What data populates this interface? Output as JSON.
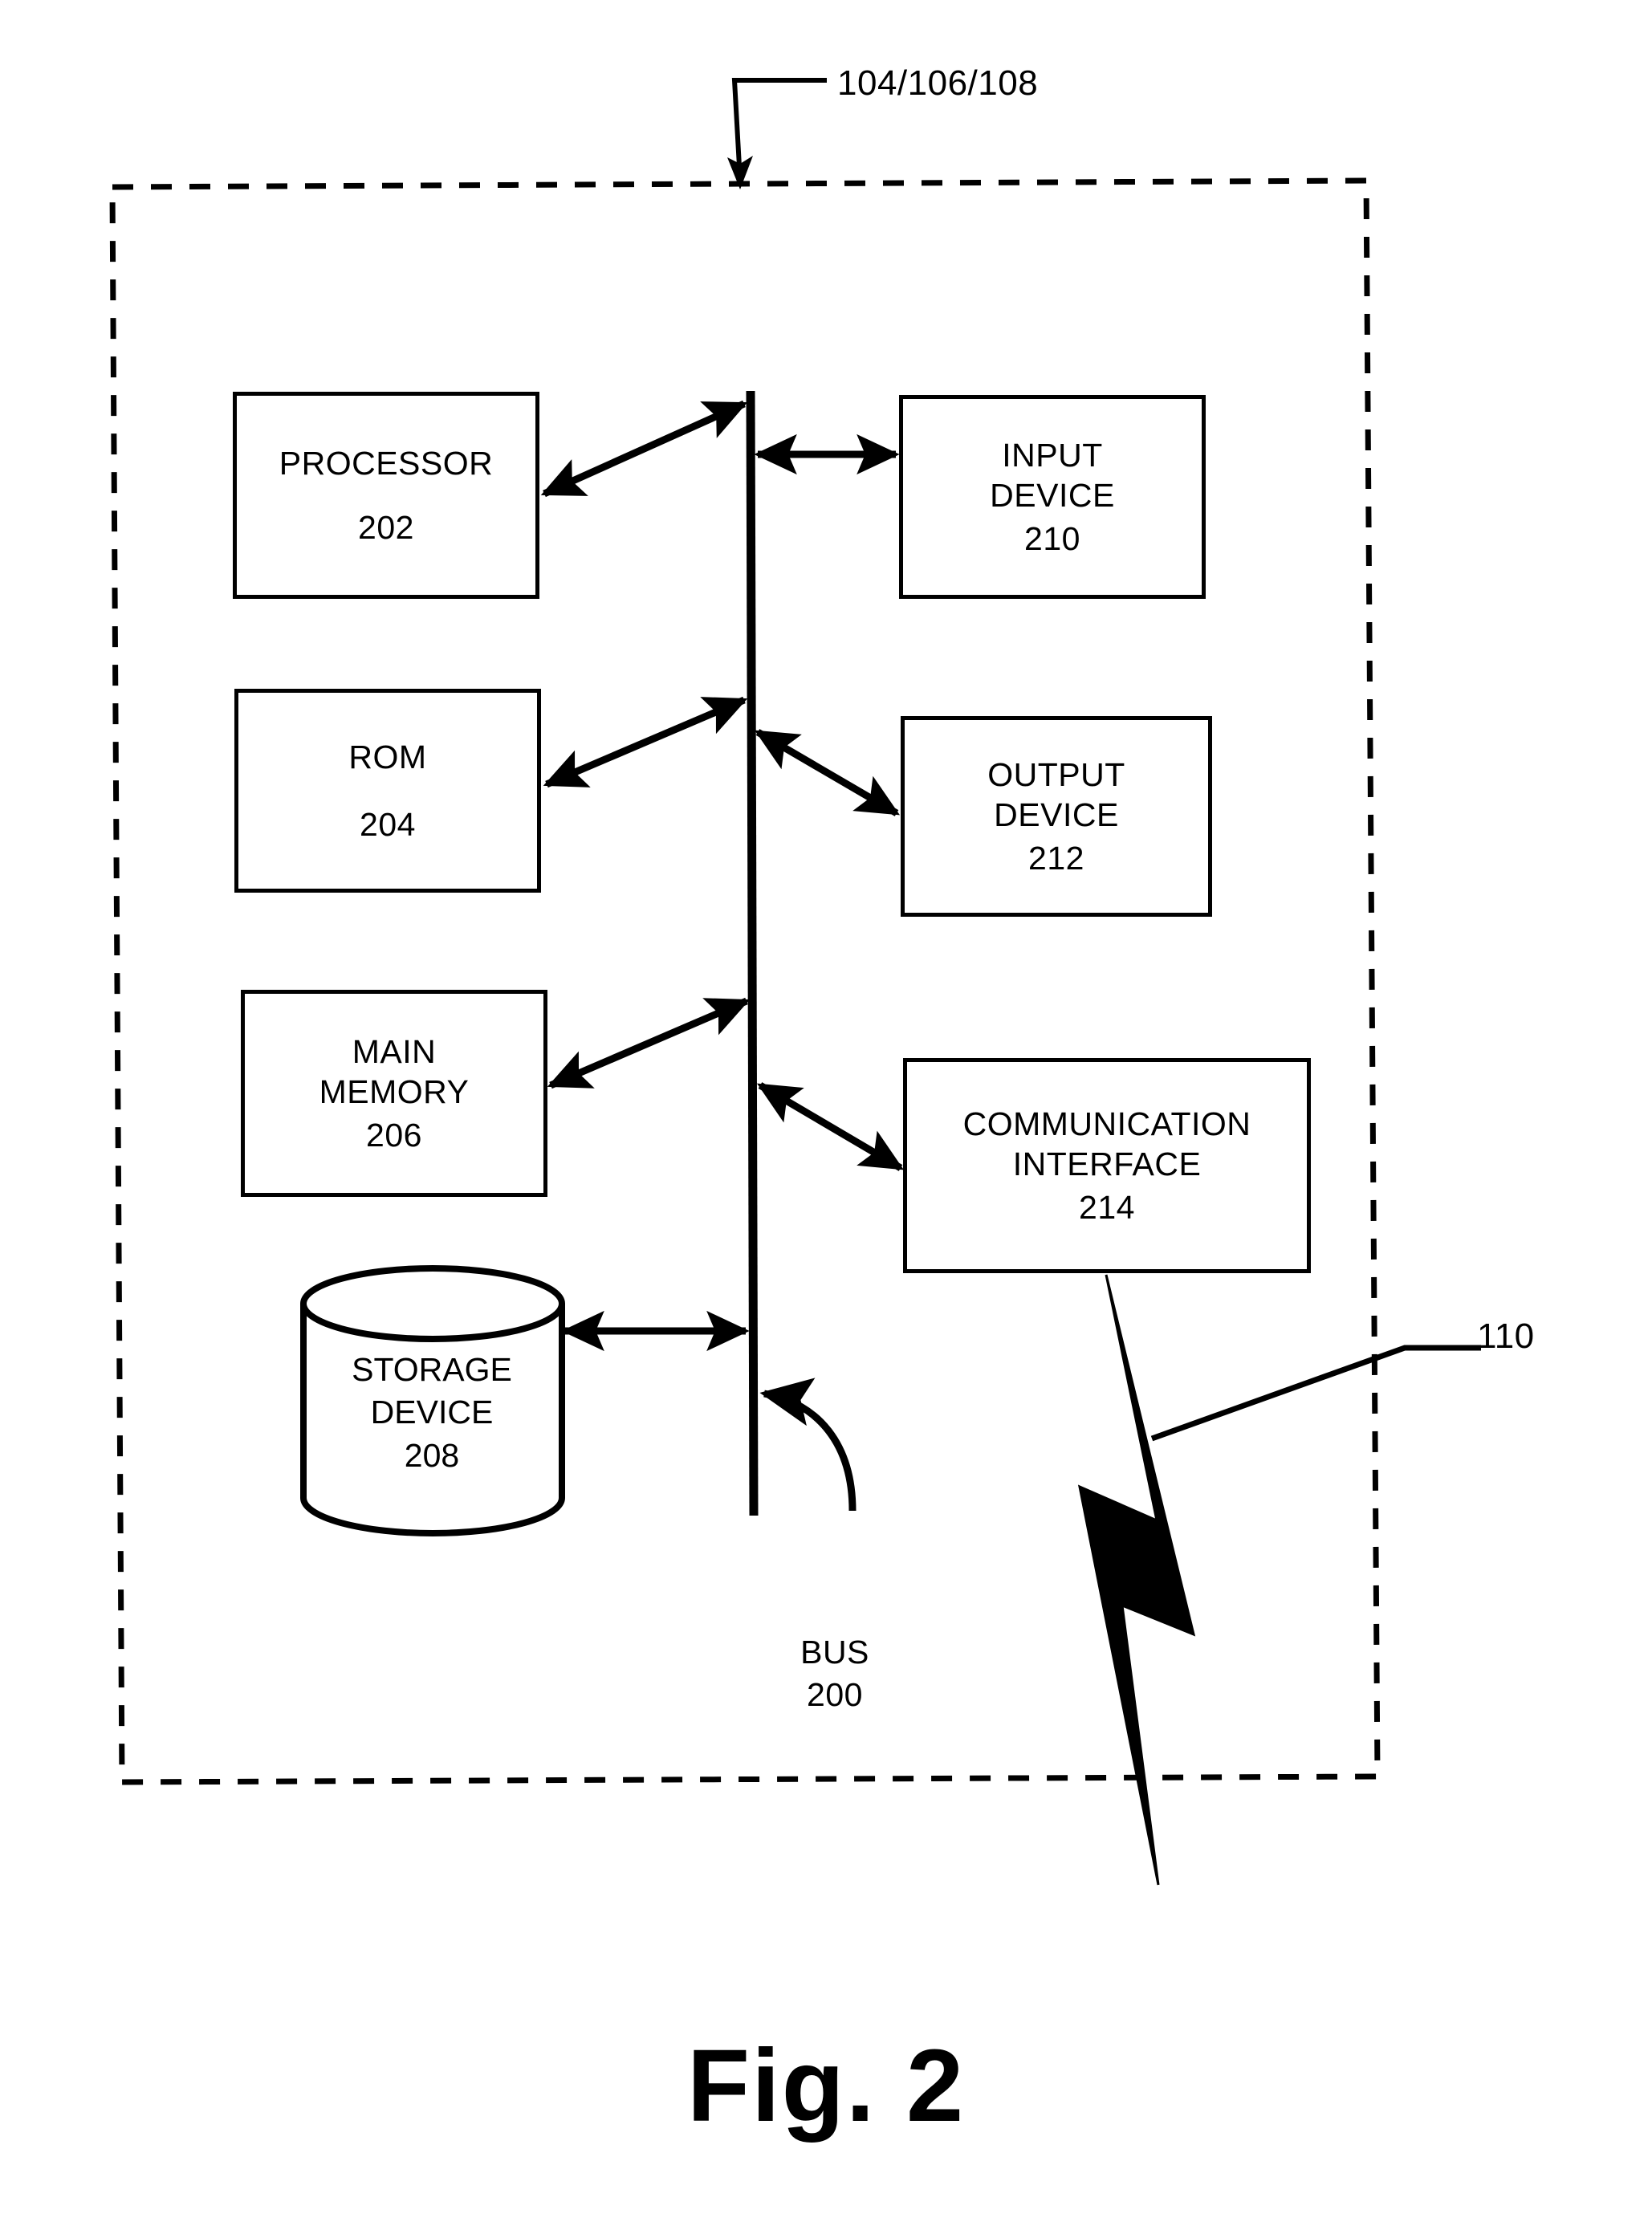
{
  "figure": {
    "caption": "Fig. 2",
    "system_reference": "104/106/108",
    "external_reference": "110",
    "bus": {
      "label": "BUS",
      "reference": "200"
    },
    "components": [
      {
        "id": "processor",
        "label": "PROCESSOR",
        "label_line2": "",
        "reference": "202",
        "shape": "rect"
      },
      {
        "id": "rom",
        "label": "ROM",
        "label_line2": "",
        "reference": "204",
        "shape": "rect"
      },
      {
        "id": "main_memory",
        "label": "MAIN",
        "label_line2": "MEMORY",
        "reference": "206",
        "shape": "rect"
      },
      {
        "id": "storage_device",
        "label": "STORAGE",
        "label_line2": "DEVICE",
        "reference": "208",
        "shape": "cylinder"
      },
      {
        "id": "input_device",
        "label": "INPUT",
        "label_line2": "DEVICE",
        "reference": "210",
        "shape": "rect"
      },
      {
        "id": "output_device",
        "label": "OUTPUT",
        "label_line2": "DEVICE",
        "reference": "212",
        "shape": "rect"
      },
      {
        "id": "comm_interface",
        "label": "COMMUNICATION",
        "label_line2": "INTERFACE",
        "reference": "214",
        "shape": "rect"
      }
    ],
    "colors": {
      "stroke": "#000000",
      "background": "#ffffff"
    }
  }
}
